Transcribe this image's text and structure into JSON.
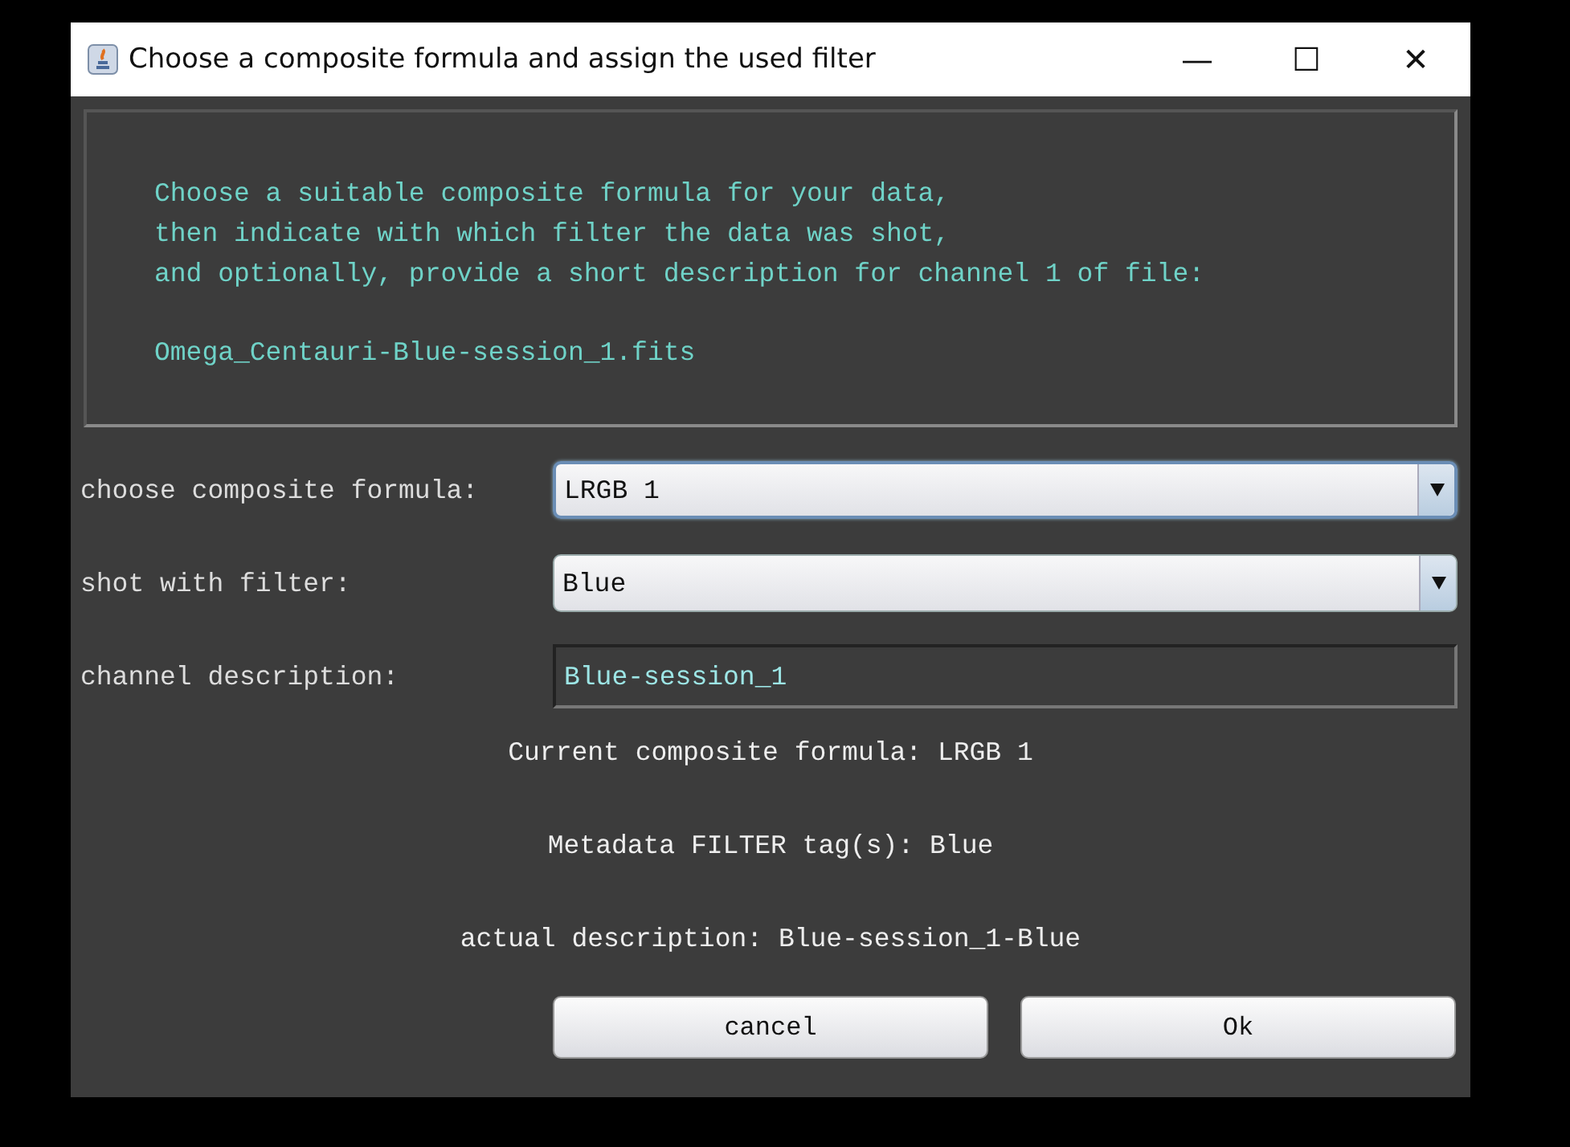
{
  "window": {
    "title": "Choose a composite formula and assign the used filter",
    "controls": [
      "—",
      "☐",
      "✕"
    ]
  },
  "instructions": [
    "Choose a suitable composite formula for your data,",
    "then indicate with which filter the data was shot,",
    "and optionally, provide a short description for channel 1 of file:"
  ],
  "file_name": "Omega_Centauri-Blue-session_1.fits",
  "fields": [
    {
      "kind": "combo",
      "label": "choose composite formula:",
      "value": "LRGB 1",
      "focused": true
    },
    {
      "kind": "combo",
      "label": "shot with filter:",
      "value": "Blue",
      "focused": false
    },
    {
      "kind": "text",
      "label": "channel description:",
      "value": "Blue-session_1",
      "focused": false
    }
  ],
  "status_lines": [
    "Current composite formula: LRGB 1",
    "Metadata FILTER tag(s): Blue",
    "actual description: Blue-session_1-Blue"
  ],
  "buttons": [
    "cancel",
    "Ok"
  ]
}
